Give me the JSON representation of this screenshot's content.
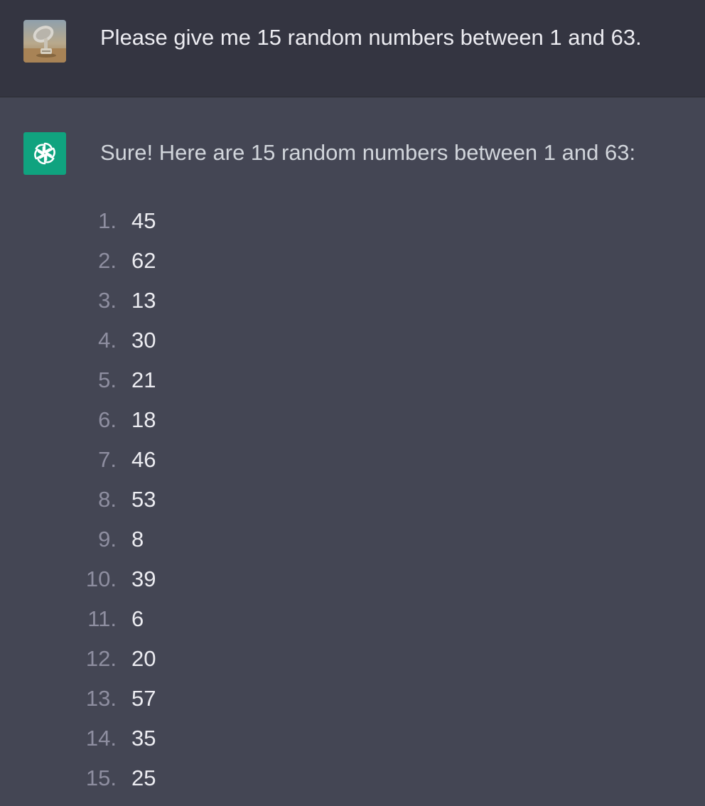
{
  "user_message": {
    "avatar_icon": "satellite-dish-photo",
    "text": "Please give me 15 random numbers between 1 and 63."
  },
  "assistant_message": {
    "avatar_icon": "openai-logo-icon",
    "accent_color": "#10a37f",
    "intro": "Sure! Here are 15 random numbers between 1 and 63:",
    "items": [
      {
        "marker": "1.",
        "value": "45"
      },
      {
        "marker": "2.",
        "value": "62"
      },
      {
        "marker": "3.",
        "value": "13"
      },
      {
        "marker": "4.",
        "value": "30"
      },
      {
        "marker": "5.",
        "value": "21"
      },
      {
        "marker": "6.",
        "value": "18"
      },
      {
        "marker": "7.",
        "value": "46"
      },
      {
        "marker": "8.",
        "value": "53"
      },
      {
        "marker": "9.",
        "value": "8"
      },
      {
        "marker": "10.",
        "value": "39"
      },
      {
        "marker": "11.",
        "value": "6"
      },
      {
        "marker": "12.",
        "value": "20"
      },
      {
        "marker": "13.",
        "value": "57"
      },
      {
        "marker": "14.",
        "value": "35"
      },
      {
        "marker": "15.",
        "value": "25"
      }
    ]
  }
}
